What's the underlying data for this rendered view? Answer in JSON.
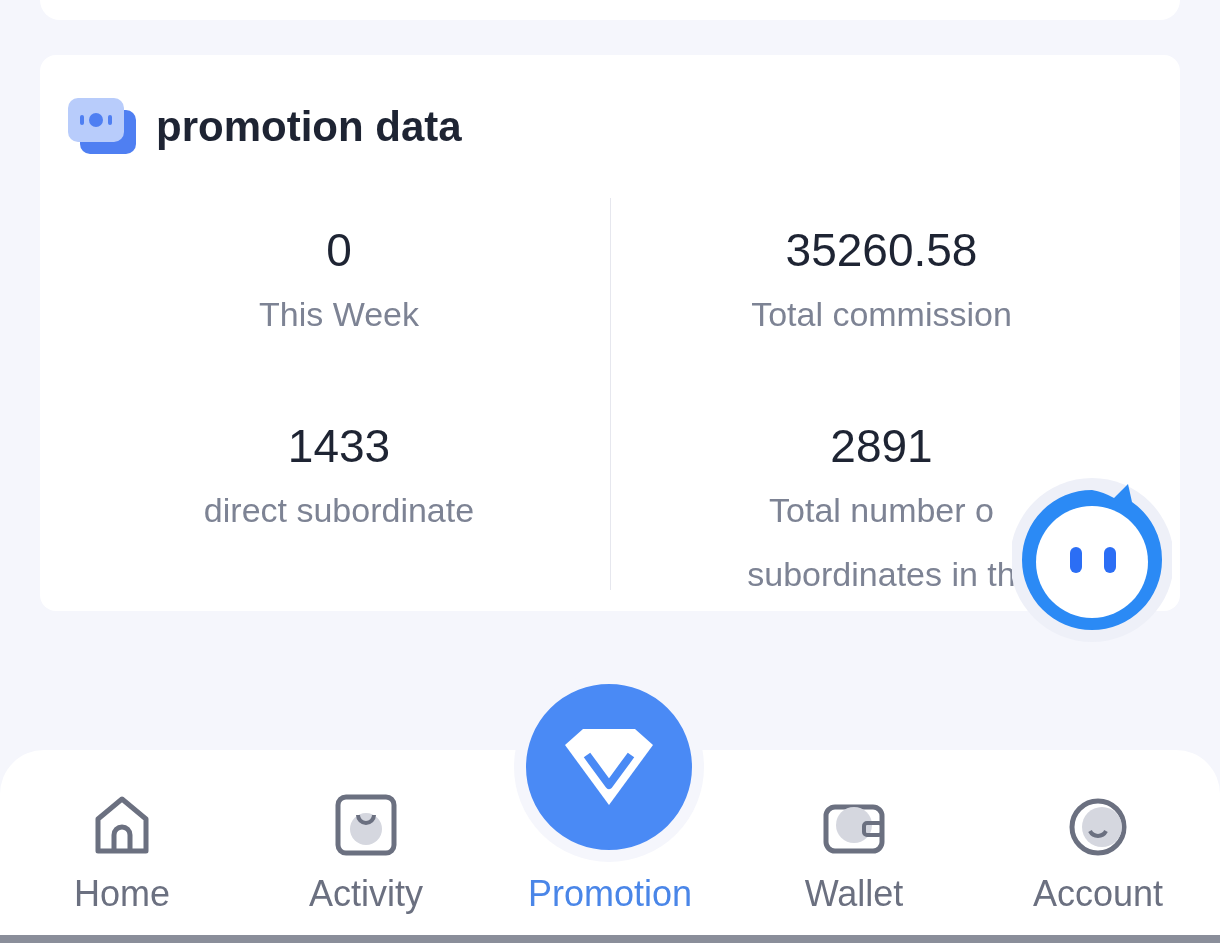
{
  "card": {
    "title": "promotion data",
    "stats": [
      {
        "value": "0",
        "label_lines": [
          "This Week"
        ]
      },
      {
        "value": "35260.58",
        "label_lines": [
          "Total commission"
        ]
      },
      {
        "value": "1433",
        "label_lines": [
          "direct subordinate"
        ]
      },
      {
        "value": "2891",
        "label_lines": [
          "Total number o",
          "subordinates in th"
        ]
      }
    ]
  },
  "nav": [
    {
      "label": "Home",
      "kind": "home",
      "selected": false
    },
    {
      "label": "Activity",
      "kind": "activity",
      "selected": false
    },
    {
      "label": "Promotion",
      "kind": "promotion",
      "selected": true
    },
    {
      "label": "Wallet",
      "kind": "wallet",
      "selected": false
    },
    {
      "label": "Account",
      "kind": "account",
      "selected": false
    }
  ]
}
